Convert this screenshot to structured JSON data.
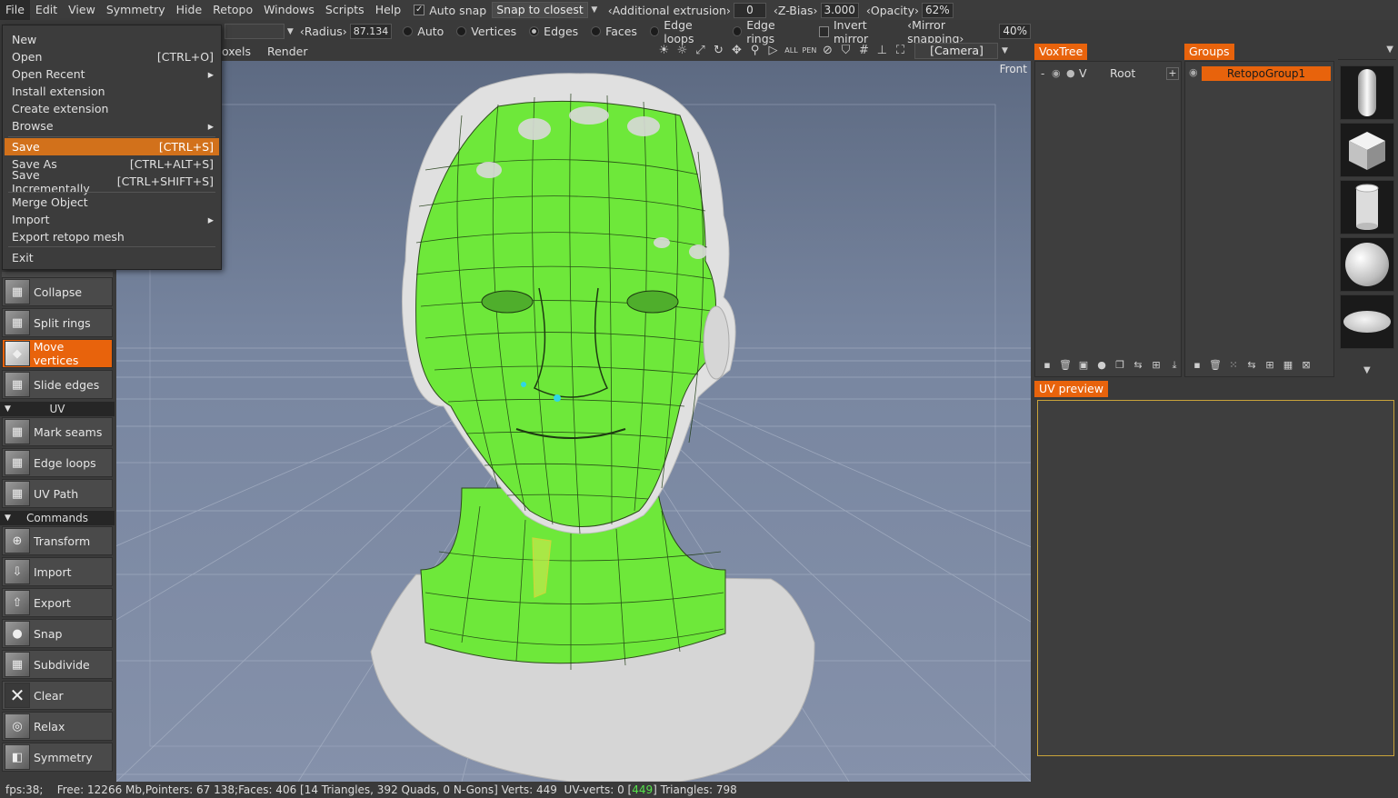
{
  "menubar": {
    "items": [
      "File",
      "Edit",
      "View",
      "Symmetry",
      "Hide",
      "Retopo",
      "Windows",
      "Scripts",
      "Help"
    ],
    "auto_snap_label": "Auto snap",
    "auto_snap_checked": true,
    "snap_mode": "Snap to closest",
    "additional_extrusion_label": "‹Additional extrusion›",
    "additional_extrusion_value": "0",
    "z_bias_label": "‹Z-Bias›",
    "z_bias_value": "3.000",
    "opacity_label": "‹Opacity›",
    "opacity_value": "62%"
  },
  "toolbar2": {
    "radius_label": "‹Radius›",
    "radius_value": "87.134",
    "modes": [
      "Auto",
      "Vertices",
      "Edges",
      "Faces",
      "Edge loops",
      "Edge rings"
    ],
    "selected_mode": "Edges",
    "invert_mirror_label": "Invert mirror",
    "mirror_snapping_label": "‹Mirror snapping›",
    "mirror_snapping_value": "40%"
  },
  "toolbar3": {
    "tab_voxels": "oxels",
    "tab_render": "Render",
    "camera": "[Camera]"
  },
  "file_menu": {
    "items": [
      {
        "label": "New",
        "shortcut": ""
      },
      {
        "label": "Open",
        "shortcut": "[CTRL+O]"
      },
      {
        "label": "Open Recent",
        "shortcut": "▸"
      },
      {
        "label": "Install extension",
        "shortcut": ""
      },
      {
        "label": "Create extension",
        "shortcut": ""
      },
      {
        "label": "Browse",
        "shortcut": "▸"
      },
      {
        "label": "Save",
        "shortcut": "[CTRL+S]"
      },
      {
        "label": "Save As",
        "shortcut": "[CTRL+ALT+S]"
      },
      {
        "label": "Save Incrementally",
        "shortcut": "[CTRL+SHIFT+S]"
      },
      {
        "label": "Merge Object",
        "shortcut": ""
      },
      {
        "label": "Import",
        "shortcut": "▸"
      },
      {
        "label": "Export retopo mesh",
        "shortcut": ""
      },
      {
        "label": "Exit",
        "shortcut": ""
      }
    ],
    "highlighted": "Save"
  },
  "left_panel": {
    "tools": [
      "Collapse",
      "Split rings",
      "Move vertices",
      "Slide edges"
    ],
    "selected_tool": "Move vertices",
    "uv_section": "UV",
    "uv_tools": [
      "Mark seams",
      "Edge loops",
      "UV Path"
    ],
    "commands_section": "Commands",
    "commands": [
      "Transform",
      "Import",
      "Export",
      "Snap",
      "Subdivide",
      "Clear",
      "Relax",
      "Symmetry"
    ]
  },
  "viewport": {
    "view_label": "Front"
  },
  "voxtree": {
    "title": "VoxTree",
    "root_label": "Root",
    "visibility_flag": "V"
  },
  "groups": {
    "title": "Groups",
    "items": [
      "RetopoGroup1"
    ]
  },
  "uv_preview": {
    "title": "UV preview"
  },
  "statusbar": {
    "fps": "fps:38;",
    "info_pre": "Free: 12266 Mb,Pointers: 67 138;Faces: 406 [14 Triangles, 392 Quads, 0 N-Gons] Verts: 449  UV-verts: 0 [",
    "uv_verts_highlight": "449",
    "info_post": "] Triangles: 798"
  },
  "colors": {
    "accent": "#e8630c",
    "retopo_mesh": "#6ee83a",
    "viewport_bg": "#7683a0"
  }
}
